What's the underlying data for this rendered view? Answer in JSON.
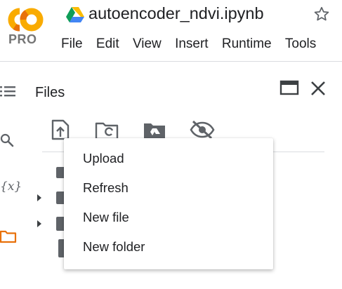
{
  "logo": {
    "badge": "PRO"
  },
  "notebook": {
    "title": "autoencoder_ndvi.ipynb"
  },
  "menu": [
    "File",
    "Edit",
    "View",
    "Insert",
    "Runtime",
    "Tools"
  ],
  "files_panel": {
    "title": "Files",
    "context_menu": [
      "Upload",
      "Refresh",
      "New file",
      "New folder"
    ]
  },
  "left_rail": {
    "variables_label": "{x}"
  },
  "colors": {
    "brand_orange": "#F9AB00",
    "brand_orange_dark": "#E8710A",
    "icon_gray": "#5f6368",
    "active_rail_icon": "#E8710A"
  },
  "icons": [
    "colab-logo",
    "drive-icon",
    "star-icon",
    "toc-icon",
    "search-icon",
    "folder-icon",
    "window-icon",
    "close-icon",
    "upload-icon",
    "refresh-folder-icon",
    "drive-folder-icon",
    "eye-off-icon",
    "caret-right-icon"
  ]
}
